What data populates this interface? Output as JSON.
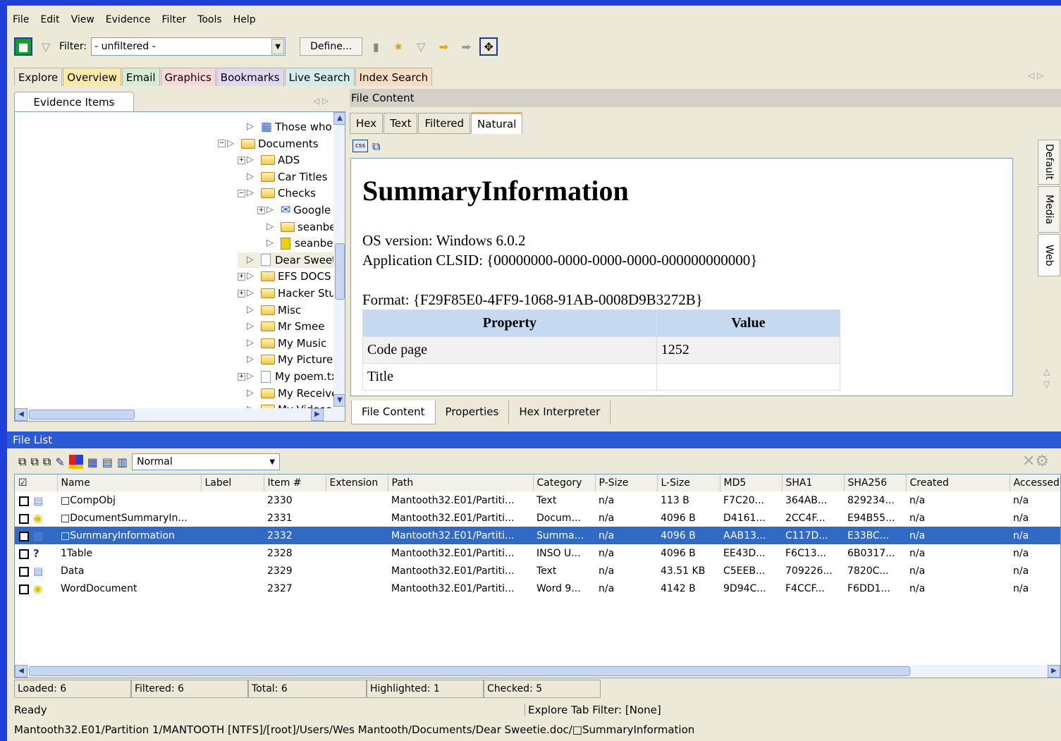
{
  "menu": [
    "File",
    "Edit",
    "View",
    "Evidence",
    "Filter",
    "Tools",
    "Help"
  ],
  "toolbar": {
    "filter_label": "Filter:",
    "filter_value": "- unfiltered -",
    "define_label": "Define..."
  },
  "main_tabs": [
    {
      "label": "Explore",
      "color": "#ece9d8"
    },
    {
      "label": "Overview",
      "color": "#fbe9a6"
    },
    {
      "label": "Email",
      "color": "#d6ecd4"
    },
    {
      "label": "Graphics",
      "color": "#f8d8d8"
    },
    {
      "label": "Bookmarks",
      "color": "#e0d8f0"
    },
    {
      "label": "Live Search",
      "color": "#d4ecec"
    },
    {
      "label": "Index Search",
      "color": "#f8dcc4"
    }
  ],
  "evidence": {
    "tab_label": "Evidence Items",
    "tree": [
      {
        "label": "Those who owes.xl:",
        "type": "sheet",
        "level": 3
      },
      {
        "label": "Documents",
        "type": "folder",
        "level": 2,
        "exp": "−"
      },
      {
        "label": "ADS",
        "type": "folder",
        "level": 3,
        "exp": "+"
      },
      {
        "label": "Car Titles",
        "type": "folder",
        "level": 3
      },
      {
        "label": "Checks",
        "type": "folder",
        "level": 3,
        "exp": "−"
      },
      {
        "label": "Google Image R",
        "type": "mail",
        "level": 4,
        "exp": "+"
      },
      {
        "label": "seanbefore",
        "type": "folder",
        "level": 4
      },
      {
        "label": "seanbefore.zip",
        "type": "zip",
        "level": 4
      },
      {
        "label": "Dear Sweetie.doc",
        "type": "file",
        "level": 3,
        "selected": true
      },
      {
        "label": "EFS DOCS",
        "type": "folder",
        "level": 3,
        "exp": "+"
      },
      {
        "label": "Hacker Stuff",
        "type": "folder",
        "level": 3,
        "exp": "+"
      },
      {
        "label": "Misc",
        "type": "folder",
        "level": 3
      },
      {
        "label": "Mr Smee",
        "type": "folder",
        "level": 3
      },
      {
        "label": "My Music",
        "type": "folder",
        "level": 3
      },
      {
        "label": "My Pictures",
        "type": "folder",
        "level": 3
      },
      {
        "label": "My poem.txt",
        "type": "file",
        "level": 3,
        "exp": "+"
      },
      {
        "label": "My Received Files",
        "type": "folder",
        "level": 3
      },
      {
        "label": "My Videos",
        "type": "folder",
        "level": 3
      }
    ]
  },
  "file_content": {
    "header": "File Content",
    "tabs": [
      "Hex",
      "Text",
      "Filtered",
      "Natural"
    ],
    "active_tab": "Natural",
    "title": "SummaryInformation",
    "os_version": "OS version: Windows 6.0.2",
    "clsid": "Application CLSID: {00000000-0000-0000-0000-000000000000}",
    "format": "Format: {F29F85E0-4FF9-1068-91AB-0008D9B3272B}",
    "table_headers": [
      "Property",
      "Value"
    ],
    "table_rows": [
      [
        "Code page",
        "1252"
      ],
      [
        "Title",
        ""
      ]
    ],
    "side_tabs": [
      "Default",
      "Media",
      "Web"
    ],
    "bottom_tabs": [
      "File Content",
      "Properties",
      "Hex Interpreter"
    ]
  },
  "file_list": {
    "header": "File List",
    "view_mode": "Normal",
    "columns": [
      "Name",
      "Label",
      "Item #",
      "Extension",
      "Path",
      "Category",
      "P-Size",
      "L-Size",
      "MD5",
      "SHA1",
      "SHA256",
      "Created",
      "Accessed"
    ],
    "rows": [
      {
        "checked": false,
        "icon": "doc",
        "name": "□CompObj",
        "label": "",
        "item": "2330",
        "ext": "",
        "path": "Mantooth32.E01/Partiti...",
        "category": "Text",
        "psize": "n/a",
        "lsize": "113 B",
        "md5": "F7C20...",
        "sha1": "364AB...",
        "sha256": "829234...",
        "created": "n/a",
        "accessed": "n/a"
      },
      {
        "checked": false,
        "icon": "bulb",
        "name": "□DocumentSummaryIn...",
        "label": "",
        "item": "2331",
        "ext": "",
        "path": "Mantooth32.E01/Partiti...",
        "category": "Docum...",
        "psize": "n/a",
        "lsize": "4096 B",
        "md5": "D4161...",
        "sha1": "2CC4F...",
        "sha256": "E94B55...",
        "created": "n/a",
        "accessed": "n/a"
      },
      {
        "checked": false,
        "icon": "info",
        "name": "□SummaryInformation",
        "label": "",
        "item": "2332",
        "ext": "",
        "path": "Mantooth32.E01/Partiti...",
        "category": "Summa...",
        "psize": "n/a",
        "lsize": "4096 B",
        "md5": "AAB13...",
        "sha1": "C117D...",
        "sha256": "E33BC...",
        "created": "n/a",
        "accessed": "n/a",
        "selected": true
      },
      {
        "checked": false,
        "icon": "question",
        "name": "1Table",
        "label": "",
        "item": "2328",
        "ext": "",
        "path": "Mantooth32.E01/Partiti...",
        "category": "INSO U...",
        "psize": "n/a",
        "lsize": "4096 B",
        "md5": "EE43D...",
        "sha1": "F6C13...",
        "sha256": "6B0317...",
        "created": "n/a",
        "accessed": "n/a"
      },
      {
        "checked": false,
        "icon": "doc",
        "name": "Data",
        "label": "",
        "item": "2329",
        "ext": "",
        "path": "Mantooth32.E01/Partiti...",
        "category": "Text",
        "psize": "n/a",
        "lsize": "43.51 KB",
        "md5": "C5EEB...",
        "sha1": "709226...",
        "sha256": "7820C...",
        "created": "n/a",
        "accessed": "n/a"
      },
      {
        "checked": false,
        "icon": "bulb",
        "name": "WordDocument",
        "label": "",
        "item": "2327",
        "ext": "",
        "path": "Mantooth32.E01/Partiti...",
        "category": "Word 9...",
        "psize": "n/a",
        "lsize": "4142 B",
        "md5": "9D94C...",
        "sha1": "F4CCF...",
        "sha256": "F6DD1...",
        "created": "n/a",
        "accessed": "n/a"
      }
    ]
  },
  "status": {
    "loaded": "Loaded: 6",
    "filtered": "Filtered: 6",
    "total": "Total: 6",
    "highlighted": "Highlighted: 1",
    "checked": "Checked: 5",
    "ready": "Ready",
    "tab_filter": "Explore Tab Filter: [None]",
    "path": "Mantooth32.E01/Partition 1/MANTOOTH [NTFS]/[root]/Users/Wes Mantooth/Documents/Dear Sweetie.doc/□SummaryInformation"
  }
}
